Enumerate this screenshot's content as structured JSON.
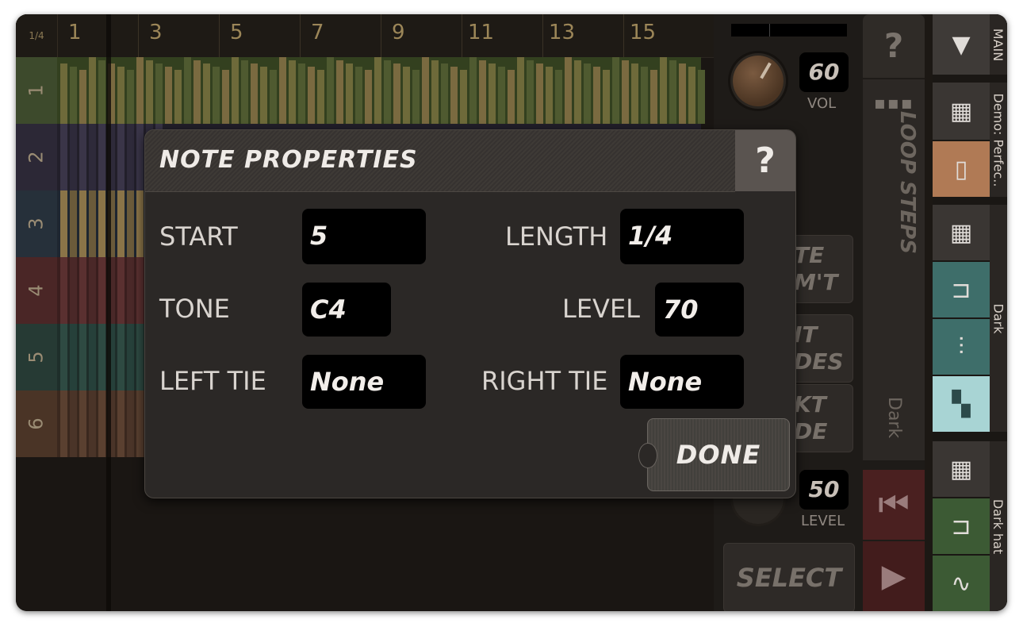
{
  "sequencer": {
    "resolution": "1/4",
    "bars": [
      "1",
      "3",
      "5",
      "7",
      "9",
      "11",
      "13",
      "15"
    ],
    "rows": [
      "1",
      "2",
      "3",
      "4",
      "5",
      "6"
    ]
  },
  "controls": {
    "vol_value": "60",
    "vol_label": "VOL",
    "level_value": "50",
    "level_label": "LEVEL",
    "help": "?",
    "loop_steps": "LOOP STEPS",
    "loop_theme": "Dark",
    "btn_a": "TE M'T",
    "btn_b": "IT DES",
    "btn_c": "KT DE",
    "select": "SELECT"
  },
  "tracks": {
    "main": "MAIN",
    "demo": "Demo: Perfec..",
    "dark": "Dark",
    "dark_hat": "Dark hat"
  },
  "dialog": {
    "title": "NOTE PROPERTIES",
    "help": "?",
    "start_label": "START",
    "start_value": "5",
    "length_label": "LENGTH",
    "length_value": "1/4",
    "tone_label": "TONE",
    "tone_value": "C4",
    "level_label": "LEVEL",
    "level_value": "70",
    "left_tie_label": "LEFT TIE",
    "left_tie_value": "None",
    "right_tie_label": "RIGHT TIE",
    "right_tie_value": "None",
    "done": "DONE"
  },
  "colors": {
    "row1": "#3d4a2c",
    "row2": "#2c2836",
    "row3": "#26303a",
    "row4": "#4a2626",
    "row5": "#263a34",
    "row6": "#4a3426",
    "accent_copper": "#b07a55",
    "accent_teal": "#3e6e6a"
  }
}
